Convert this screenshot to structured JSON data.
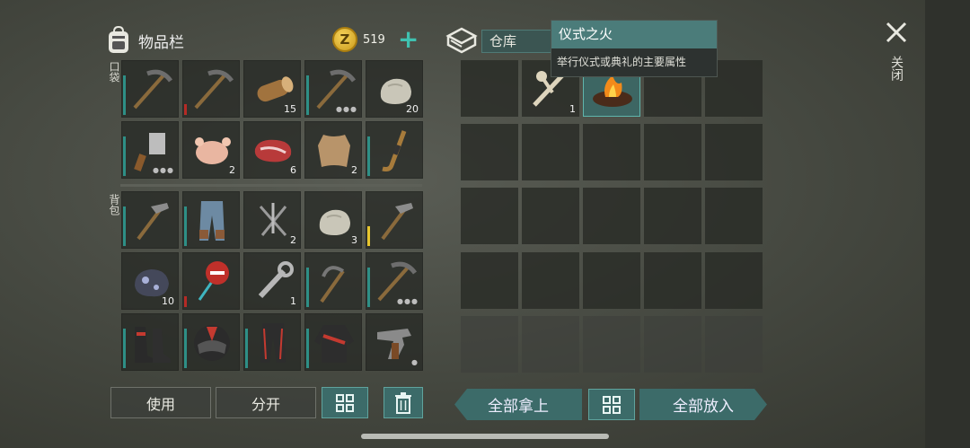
{
  "inventory": {
    "title": "物品栏",
    "coins": "519",
    "coin_symbol": "Z",
    "plus": "+",
    "pocket_label": "口袋",
    "backpack_label": "背包",
    "pocket_rows": [
      [
        {
          "icon": "pickaxe-icon",
          "qty": "",
          "bar": "teal",
          "dots": ""
        },
        {
          "icon": "pickaxe-icon",
          "qty": "",
          "bar": "red",
          "dots": ""
        },
        {
          "icon": "log-icon",
          "qty": "15",
          "bar": "",
          "dots": ""
        },
        {
          "icon": "pickaxe-icon",
          "qty": "",
          "bar": "teal",
          "dots": "●●●"
        },
        {
          "icon": "stone-icon",
          "qty": "20",
          "bar": "",
          "dots": ""
        }
      ],
      [
        {
          "icon": "cleaver-icon",
          "qty": "",
          "bar": "teal",
          "dots": "●●●"
        },
        {
          "icon": "raw-chicken-icon",
          "qty": "2",
          "bar": "",
          "dots": ""
        },
        {
          "icon": "raw-meat-icon",
          "qty": "6",
          "bar": "",
          "dots": ""
        },
        {
          "icon": "hide-icon",
          "qty": "2",
          "bar": "",
          "dots": ""
        },
        {
          "icon": "hockey-stick-icon",
          "qty": "",
          "bar": "teal",
          "dots": ""
        }
      ]
    ],
    "backpack_rows": [
      [
        {
          "icon": "hammer-icon",
          "qty": "",
          "bar": "teal",
          "dots": ""
        },
        {
          "icon": "pants-icon",
          "qty": "",
          "bar": "teal",
          "dots": ""
        },
        {
          "icon": "nails-icon",
          "qty": "2",
          "bar": "",
          "dots": ""
        },
        {
          "icon": "stone-icon",
          "qty": "3",
          "bar": "",
          "dots": ""
        },
        {
          "icon": "hammer-icon",
          "qty": "",
          "bar": "yellow",
          "dots": ""
        }
      ],
      [
        {
          "icon": "ore-icon",
          "qty": "10",
          "bar": "",
          "dots": ""
        },
        {
          "icon": "stop-sign-icon",
          "qty": "",
          "bar": "red",
          "dots": ""
        },
        {
          "icon": "wrench-icon",
          "qty": "1",
          "bar": "",
          "dots": ""
        },
        {
          "icon": "sickle-icon",
          "qty": "",
          "bar": "teal",
          "dots": ""
        },
        {
          "icon": "pickaxe-icon",
          "qty": "",
          "bar": "teal",
          "dots": "●●●"
        }
      ],
      [
        {
          "icon": "boots-icon",
          "qty": "",
          "bar": "teal",
          "dots": ""
        },
        {
          "icon": "helmet-icon",
          "qty": "",
          "bar": "teal",
          "dots": ""
        },
        {
          "icon": "leather-pants-icon",
          "qty": "",
          "bar": "teal",
          "dots": ""
        },
        {
          "icon": "jacket-icon",
          "qty": "",
          "bar": "teal",
          "dots": ""
        },
        {
          "icon": "revolver-icon",
          "qty": "",
          "bar": "",
          "dots": "●"
        }
      ]
    ],
    "use_label": "使用",
    "split_label": "分开"
  },
  "warehouse": {
    "title": "仓库",
    "take_all_label": "全部拿上",
    "put_all_label": "全部放入",
    "items": [
      {
        "row": 0,
        "col": 1,
        "icon": "bones-icon",
        "qty": "1"
      },
      {
        "row": 0,
        "col": 2,
        "icon": "ritual-fire-icon",
        "qty": "",
        "selected": true
      }
    ]
  },
  "tooltip": {
    "title": "仪式之火",
    "description": "举行仪式或典礼的主要属性"
  },
  "close_label": "关闭",
  "colors": {
    "accent": "#3c6b69",
    "teal_bar": "#2e8f86",
    "red_bar": "#b52a25",
    "yellow_bar": "#e6c52e"
  }
}
